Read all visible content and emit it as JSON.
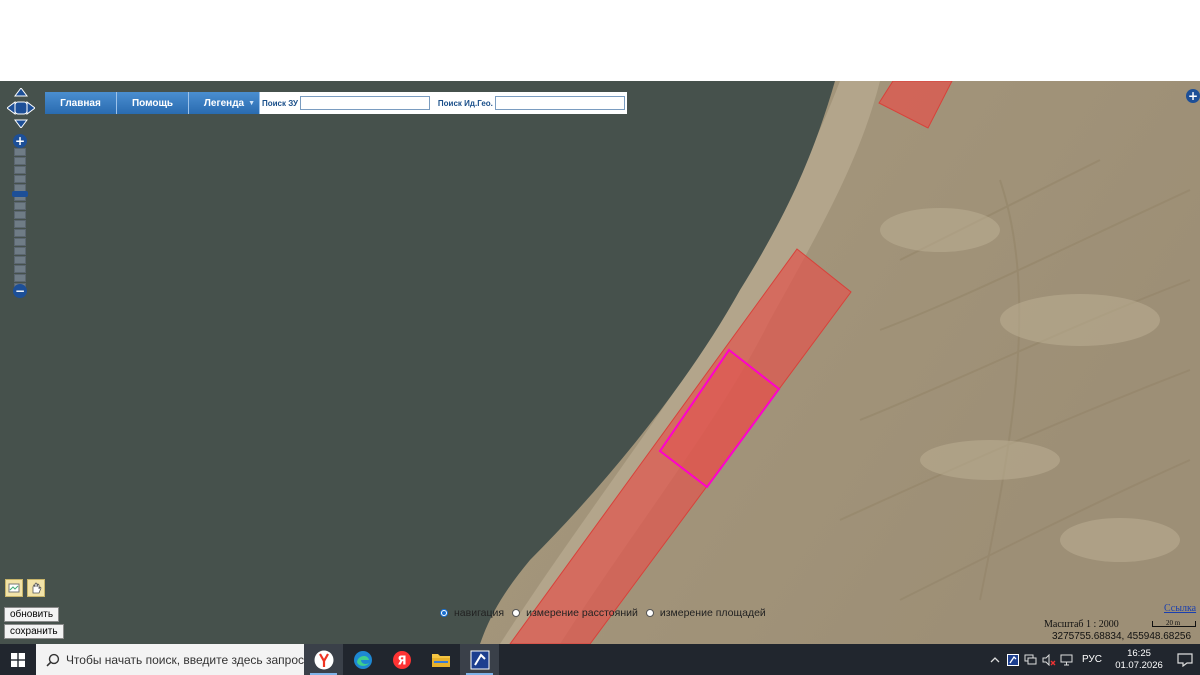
{
  "menu": {
    "home": "Главная",
    "help": "Помощь",
    "legend": "Легенда"
  },
  "search": {
    "parcel_label": "Поиск ЗУ",
    "parcel_value": "",
    "geoid_label": "Поиск Ид.Гео.",
    "geoid_value": ""
  },
  "zoom": {
    "in": "+",
    "out": "−"
  },
  "actions": {
    "refresh": "обновить",
    "save": "сохранить"
  },
  "modes": {
    "selected": "навигация",
    "items": [
      "навигация",
      "измерение расстояний",
      "измерение площадей"
    ]
  },
  "map_info": {
    "link": "Ссылка",
    "scale": "Масштаб 1 : 2000",
    "scale_bar": "20 m",
    "coordinates": "3275755.68834, 455948.68256"
  },
  "colors": {
    "parcel_fill": "#e0564e",
    "parcel_outline": "#d8413a",
    "selected_outline": "#ff00cc",
    "water": "#46514c",
    "menu_blue": "#2a6bb0",
    "taskbar": "#21262e"
  },
  "taskbar": {
    "search_placeholder": "Чтобы начать поиск, введите здесь запрос",
    "apps": [
      "yandex-browser-icon",
      "edge-icon",
      "yandex-icon",
      "file-explorer-icon",
      "photo-app-icon"
    ],
    "language": "РУС",
    "time": "16:25",
    "date": "01.07.2026"
  }
}
